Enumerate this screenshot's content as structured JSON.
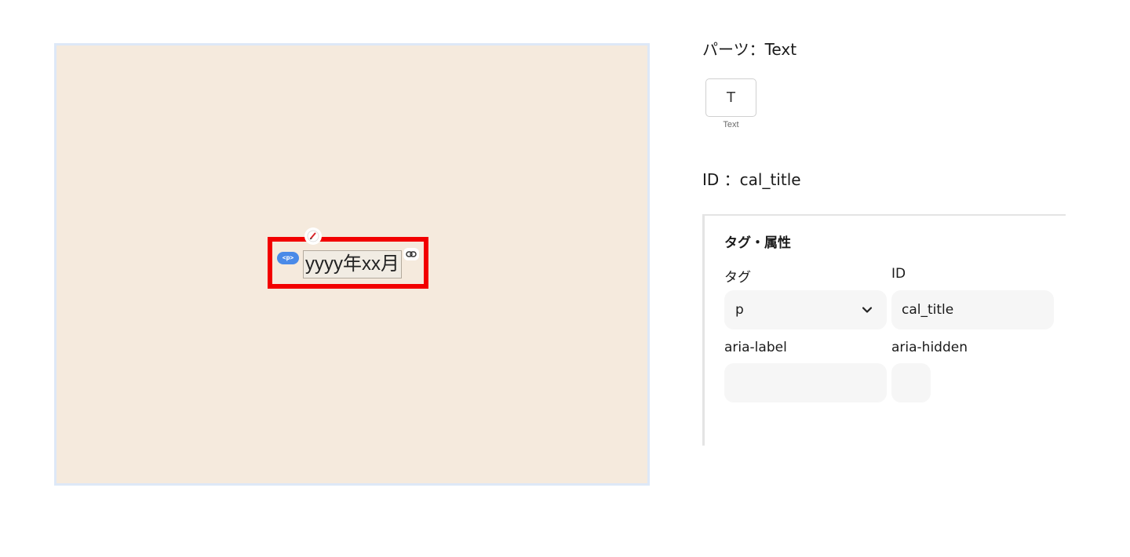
{
  "canvas": {
    "element_text": "yyyy年xx月",
    "tag_badge": "<p>"
  },
  "panel": {
    "parts_title": "パーツ：Text",
    "part_icon_glyph": "T",
    "part_label": "Text",
    "id_title": "ID ：cal_title",
    "section_heading": "タグ・属性",
    "fields": {
      "tag_label": "タグ",
      "tag_value": "p",
      "id_label": "ID",
      "id_value": "cal_title",
      "aria_label_label": "aria-label",
      "aria_label_value": "",
      "aria_hidden_label": "aria-hidden",
      "aria_hidden_value": ""
    }
  },
  "colors": {
    "canvas_background": "#f5eadd",
    "canvas_border": "#dde8f7",
    "highlight_border": "#f20000",
    "tag_badge": "#4a8ae8",
    "field_background": "#f6f6f6"
  }
}
